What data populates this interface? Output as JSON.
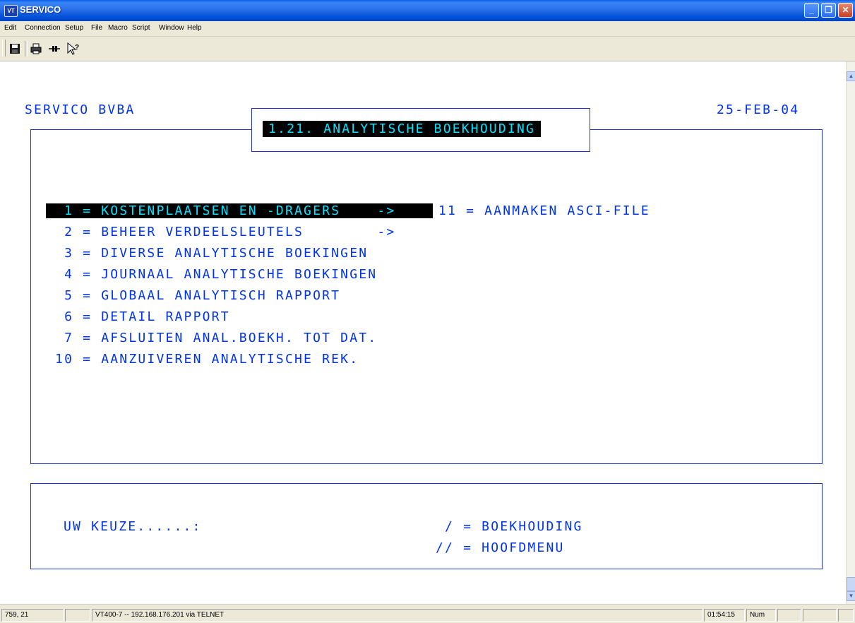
{
  "window": {
    "icon_label": "VT",
    "title": "SERVICO",
    "minimize_glyph": "_",
    "maximize_glyph": "❐",
    "close_glyph": "✕"
  },
  "menu": [
    "Edit",
    "Connection",
    "Setup",
    "File",
    "Macro",
    "Script",
    "Window",
    "Help"
  ],
  "toolbar": {
    "icons": [
      "save-icon",
      "print-icon",
      "connect-icon",
      "help-cursor-icon"
    ]
  },
  "terminal": {
    "company": "SERVICO BVBA",
    "date": "25-FEB-04",
    "screen_title": "1.21. ANALYTISCHE BOEKHOUDING",
    "menu_lines": [
      "  1 = KOSTENPLAATSEN EN -DRAGERS    -> ",
      "  2 = BEHEER VERDEELSLEUTELS        ->",
      "  3 = DIVERSE ANALYTISCHE BOEKINGEN",
      "  4 = JOURNAAL ANALYTISCHE BOEKINGEN",
      "  5 = GLOBAAL ANALYTISCH RAPPORT",
      "  6 = DETAIL RAPPORT",
      "  7 = AFSLUITEN ANAL.BOEKH. TOT DAT.",
      " 10 = AANZUIVEREN ANALYTISCHE REK."
    ],
    "right_option": "11 = AANMAKEN ASCI-FILE",
    "prompt": "UW KEUZE......:",
    "nav_1": " / = BOEKHOUDING",
    "nav_2": "// = HOOFDMENU"
  },
  "status": {
    "coords": "759, 21",
    "blank": "",
    "connection": "VT400-7 -- 192.168.176.201 via TELNET",
    "time": "01:54:15",
    "num": "Num"
  },
  "colors": {
    "terminal_text": "#0033ee",
    "highlight_bg": "#000000",
    "highlight_text": "#00e5ff",
    "titlebar": "#0050d8"
  }
}
